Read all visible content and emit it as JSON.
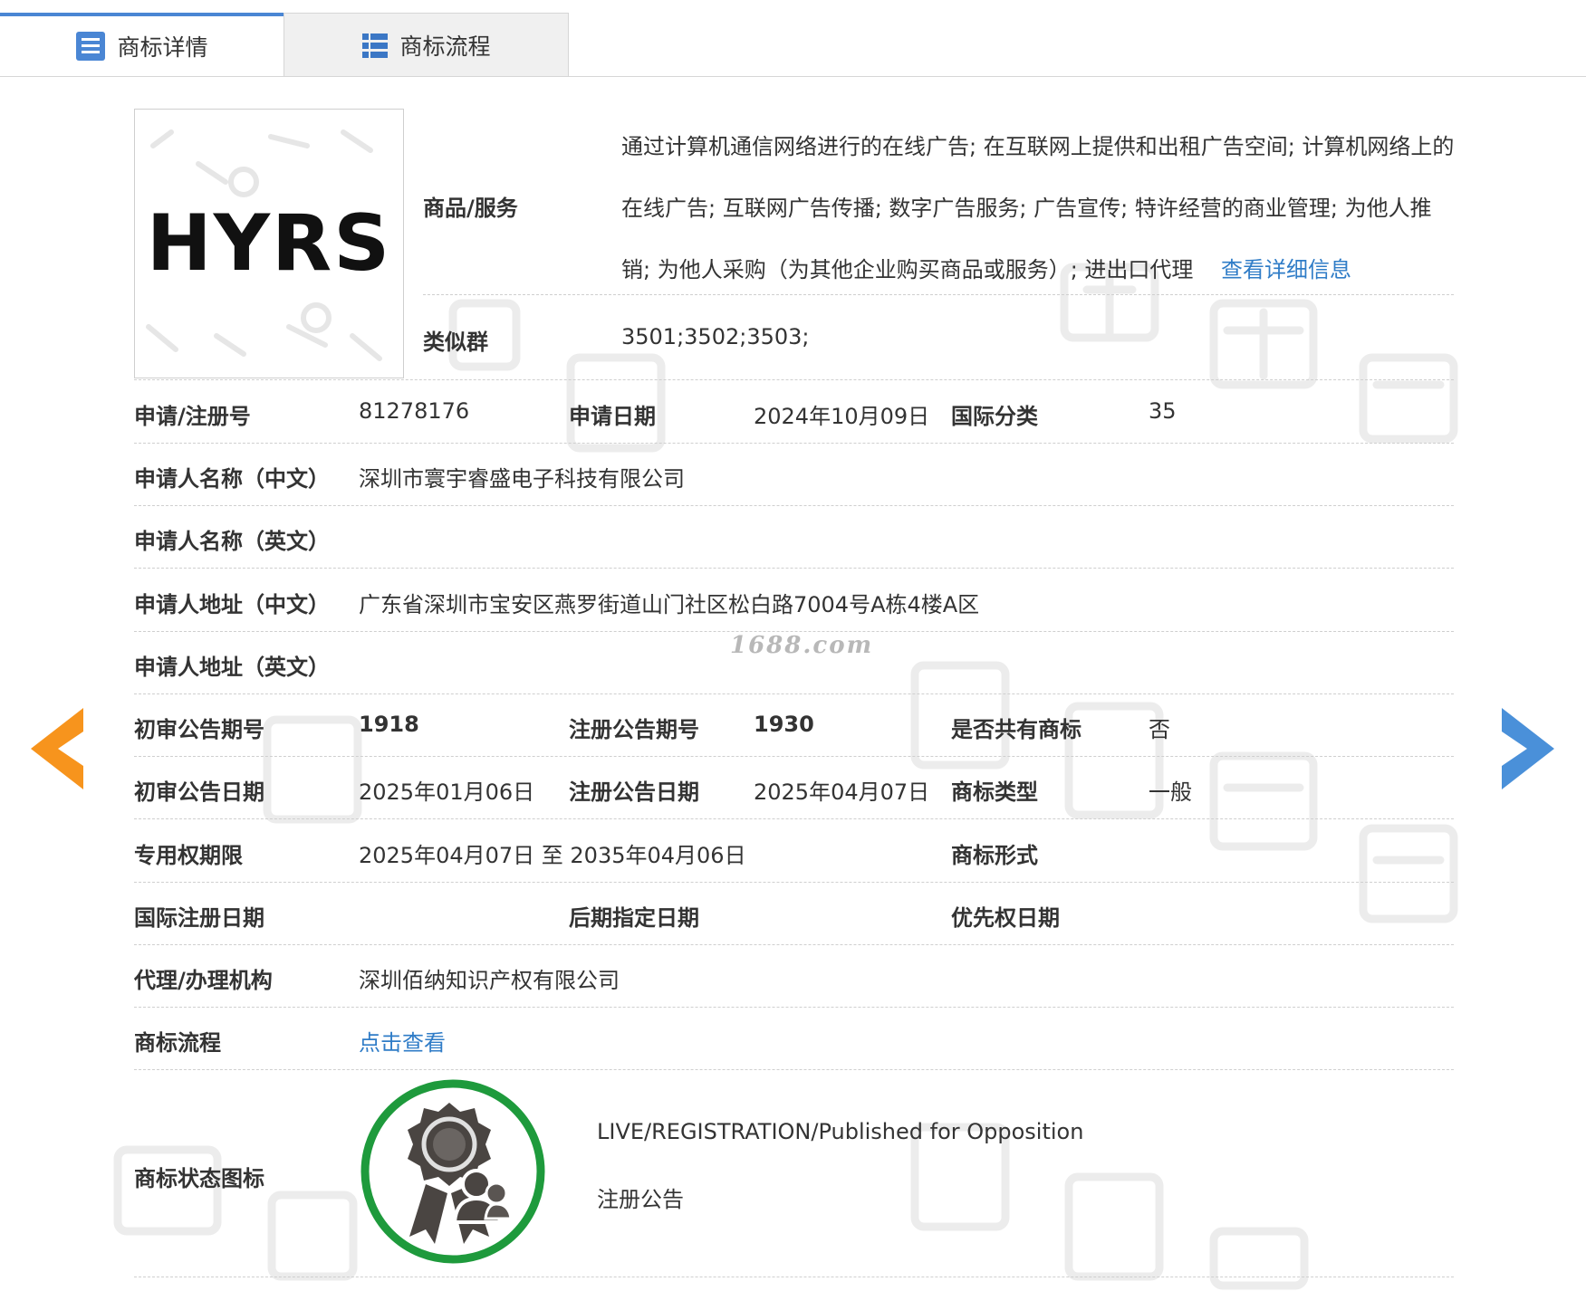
{
  "tabs": [
    {
      "label": "商标详情",
      "active": true
    },
    {
      "label": "商标流程",
      "active": false
    }
  ],
  "logo_text": "HYRS",
  "goods": {
    "label": "商品/服务",
    "value": "通过计算机通信网络进行的在线广告; 在互联网上提供和出租广告空间; 计算机网络上的在线广告; 互联网广告传播; 数字广告服务; 广告宣传; 特许经营的商业管理; 为他人推销; 为他人采购（为其他企业购买商品或服务）; 进出口代理",
    "detail_link": "查看详细信息"
  },
  "similar_group": {
    "label": "类似群",
    "value": "3501;3502;3503;"
  },
  "fields": {
    "reg_no_label": "申请/注册号",
    "reg_no": "81278176",
    "apply_date_label": "申请日期",
    "apply_date": "2024年10月09日",
    "intl_class_label": "国际分类",
    "intl_class": "35",
    "applicant_cn_label": "申请人名称（中文）",
    "applicant_cn": "深圳市寰宇睿盛电子科技有限公司",
    "applicant_en_label": "申请人名称（英文）",
    "applicant_en": "",
    "address_cn_label": "申请人地址（中文）",
    "address_cn": "广东省深圳市宝安区燕罗街道山门社区松白路7004号A栋4楼A区",
    "address_en_label": "申请人地址（英文）",
    "address_en": "",
    "prelim_issue_label": "初审公告期号",
    "prelim_issue": "1918",
    "reg_issue_label": "注册公告期号",
    "reg_issue": "1930",
    "shared_label": "是否共有商标",
    "shared": "否",
    "prelim_date_label": "初审公告日期",
    "prelim_date": "2025年01月06日",
    "reg_date_label": "注册公告日期",
    "reg_date": "2025年04月07日",
    "tm_type_label": "商标类型",
    "tm_type": "一般",
    "term_label": "专用权期限",
    "term": "2025年04月07日 至 2035年04月06日",
    "tm_form_label": "商标形式",
    "tm_form": "",
    "intl_reg_date_label": "国际注册日期",
    "intl_reg_date": "",
    "later_date_label": "后期指定日期",
    "later_date": "",
    "priority_date_label": "优先权日期",
    "priority_date": "",
    "agency_label": "代理/办理机构",
    "agency": "深圳佰纳知识产权有限公司",
    "flow_label": "商标流程",
    "flow_link": "点击查看",
    "status_label": "商标状态图标",
    "status_en": "LIVE/REGISTRATION/Published for Opposition",
    "status_cn": "注册公告"
  },
  "site_watermark": "1688.com",
  "colors": {
    "link": "#2f7cc7",
    "tab_accent": "#4a86d4",
    "prev_arrow": "#f7941d",
    "next_arrow": "#4a90d9",
    "status_ring": "#1e9a3c"
  },
  "icons": {
    "tab_detail": "document-list-icon",
    "tab_flow": "grid-list-icon",
    "prev": "chevron-left-icon",
    "next": "chevron-right-icon",
    "status": "award-badge-icon"
  }
}
